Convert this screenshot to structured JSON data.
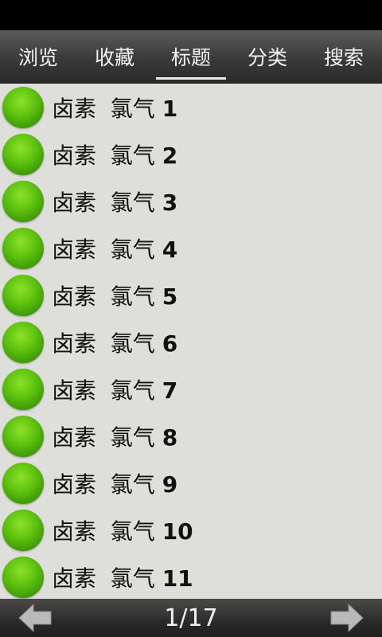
{
  "tabs": [
    {
      "label": "浏览",
      "active": false
    },
    {
      "label": "收藏",
      "active": false
    },
    {
      "label": "标题",
      "active": true
    },
    {
      "label": "分类",
      "active": false
    },
    {
      "label": "搜索",
      "active": false
    }
  ],
  "list": {
    "icon": "green-ball-icon",
    "items": [
      {
        "title": "卤素  氯气 ",
        "number": "1"
      },
      {
        "title": "卤素  氯气 ",
        "number": "2"
      },
      {
        "title": "卤素  氯气 ",
        "number": "3"
      },
      {
        "title": "卤素  氯气 ",
        "number": "4"
      },
      {
        "title": "卤素  氯气 ",
        "number": "5"
      },
      {
        "title": "卤素  氯气 ",
        "number": "6"
      },
      {
        "title": "卤素  氯气 ",
        "number": "7"
      },
      {
        "title": "卤素  氯气 ",
        "number": "8"
      },
      {
        "title": "卤素  氯气 ",
        "number": "9"
      },
      {
        "title": "卤素  氯气 ",
        "number": "10"
      },
      {
        "title": "卤素  氯气 ",
        "number": "11"
      }
    ]
  },
  "pagination": {
    "indicator": "1/17",
    "prev_icon": "arrow-left-icon",
    "next_icon": "arrow-right-icon"
  },
  "colors": {
    "list_background": "#dededa",
    "ball_green": "#5fc40f",
    "arrow_gray": "#b9b9b9"
  }
}
